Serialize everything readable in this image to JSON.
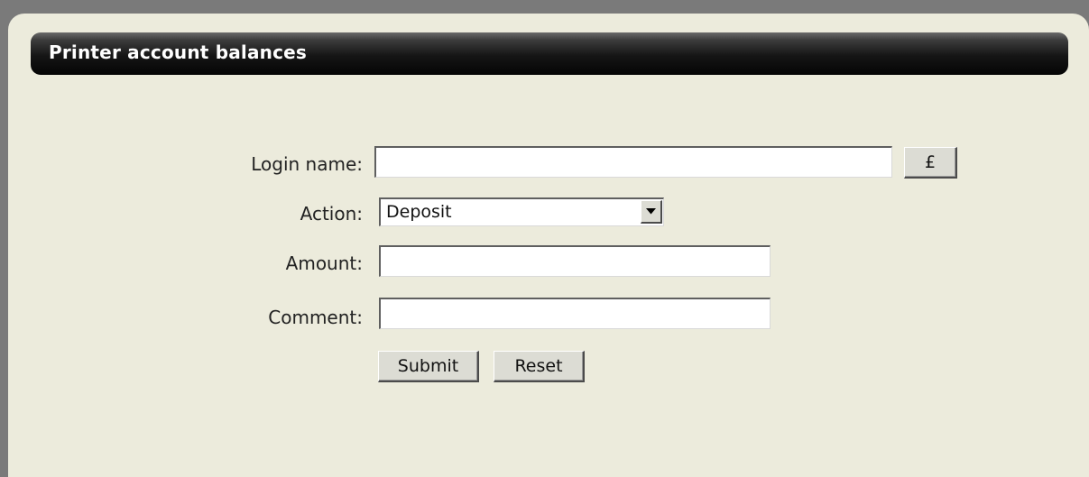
{
  "header": {
    "title": "Printer account balances"
  },
  "form": {
    "login_label": "Login name:",
    "login_value": "",
    "currency_button": "£",
    "action_label": "Action:",
    "action_selected": "Deposit",
    "amount_label": "Amount:",
    "amount_value": "",
    "comment_label": "Comment:",
    "comment_value": "",
    "submit_label": "Submit",
    "reset_label": "Reset"
  },
  "colors": {
    "panel_background": "#ecebdc",
    "header_background": "#111111",
    "header_text": "#ffffff"
  }
}
